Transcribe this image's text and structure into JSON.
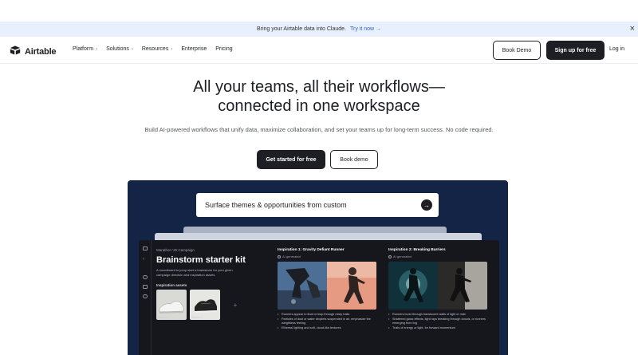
{
  "announcement": {
    "text": "Bring your Airtable data into Claude.",
    "cta": "Try it now →",
    "close": "×"
  },
  "nav": {
    "logo": "Airtable",
    "links": [
      {
        "label": "Platform",
        "chevron": "›"
      },
      {
        "label": "Solutions",
        "chevron": "›"
      },
      {
        "label": "Resources",
        "chevron": "›"
      },
      {
        "label": "Enterprise",
        "chevron": ""
      },
      {
        "label": "Pricing",
        "chevron": ""
      }
    ],
    "book_demo": "Book Demo",
    "signup": "Sign up for free",
    "login": "Log in"
  },
  "hero": {
    "title_line1": "All your teams, all their workflows—",
    "title_line2": "connected in one workspace",
    "subtitle": "Build AI-powered workflows that unify data, maximize collaboration, and set your teams up for long-term success. No code required.",
    "primary_cta": "Get started for free",
    "secondary_cta": "Book demo"
  },
  "showcase": {
    "prompt": "Surface themes & opportunities from custom",
    "prompt_go": "→",
    "kit": {
      "eyebrow": "Marathon '25 Campaign",
      "title": "Brainstorm starter kit",
      "description": "A moodboard to jump start a brainstorm for your given campaign direction and inspiration assets",
      "assets_label": "Inspiration assets",
      "assets": [
        "Source 1",
        "Source 2"
      ],
      "add": "+"
    },
    "inspirations": [
      {
        "title": "Inspiration 1: Gravity Defiant Runner",
        "badge": "AI generated",
        "bullets": [
          "Runners appear to float or leap through misty trails",
          "Particles of dust or water droplets suspended in air, emphasize the weightless feeling",
          "Ethereal lighting and soft, cloud-like textures"
        ]
      },
      {
        "title": "Inspiration 2: Breaking Barriers",
        "badge": "AI generated",
        "bullets": [
          "Runners burst through translucent walls of light or mist",
          "Shattered glass effects, light rays breaking through clouds, or runners emerging from fog",
          "Trails of energy or light, for forward momentum"
        ]
      }
    ]
  },
  "colors": {
    "dark": "#1d1f25",
    "announce_bg": "#e8f0fd",
    "link_blue": "#2d5fd6",
    "showcase_bg": "#132447"
  }
}
